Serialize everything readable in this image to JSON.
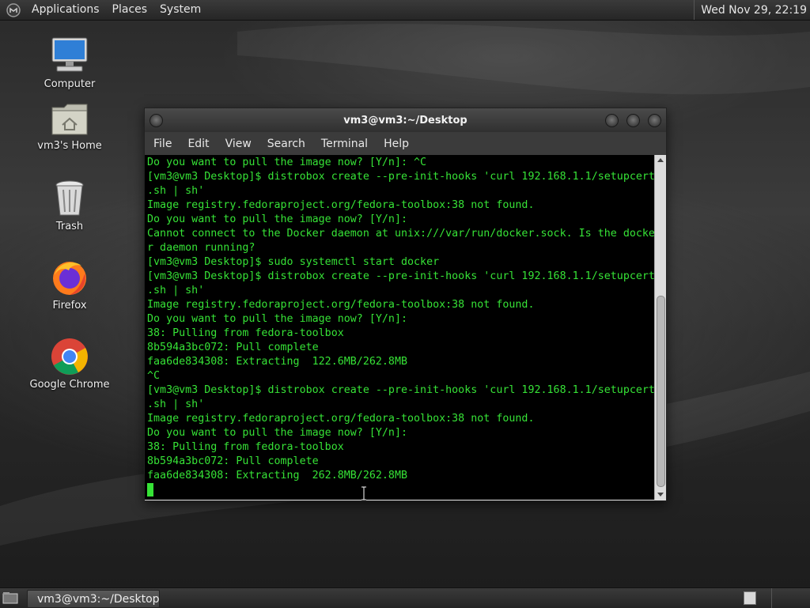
{
  "top_panel": {
    "menus": [
      "Applications",
      "Places",
      "System"
    ],
    "clock": "Wed Nov 29, 22:19",
    "logo_icon": "mate-logo-icon"
  },
  "desktop": {
    "icons": [
      {
        "label": "Computer",
        "icon": "computer-icon"
      },
      {
        "label": "vm3's Home",
        "icon": "home-folder-icon"
      },
      {
        "label": "Trash",
        "icon": "trash-icon"
      },
      {
        "label": "Firefox",
        "icon": "firefox-icon"
      },
      {
        "label": "Google Chrome",
        "icon": "chrome-icon"
      }
    ]
  },
  "terminal": {
    "title": "vm3@vm3:~/Desktop",
    "menu": [
      "File",
      "Edit",
      "View",
      "Search",
      "Terminal",
      "Help"
    ],
    "text_color": "#36e236",
    "lines": [
      "Do you want to pull the image now? [Y/n]: ^C",
      "[vm3@vm3 Desktop]$ distrobox create --pre-init-hooks 'curl 192.168.1.1/setupcert",
      ".sh | sh'",
      "Image registry.fedoraproject.org/fedora-toolbox:38 not found.",
      "Do you want to pull the image now? [Y/n]:",
      "Cannot connect to the Docker daemon at unix:///var/run/docker.sock. Is the docke",
      "r daemon running?",
      "[vm3@vm3 Desktop]$ sudo systemctl start docker",
      "[vm3@vm3 Desktop]$ distrobox create --pre-init-hooks 'curl 192.168.1.1/setupcert",
      ".sh | sh'",
      "Image registry.fedoraproject.org/fedora-toolbox:38 not found.",
      "Do you want to pull the image now? [Y/n]:",
      "38: Pulling from fedora-toolbox",
      "8b594a3bc072: Pull complete",
      "faa6de834308: Extracting  122.6MB/262.8MB",
      "^C",
      "[vm3@vm3 Desktop]$ distrobox create --pre-init-hooks 'curl 192.168.1.1/setupcert",
      ".sh | sh'",
      "Image registry.fedoraproject.org/fedora-toolbox:38 not found.",
      "Do you want to pull the image now? [Y/n]:",
      "38: Pulling from fedora-toolbox",
      "8b594a3bc072: Pull complete",
      "faa6de834308: Extracting  262.8MB/262.8MB"
    ]
  },
  "bottom_panel": {
    "task_label": "vm3@vm3:~/Desktop"
  }
}
